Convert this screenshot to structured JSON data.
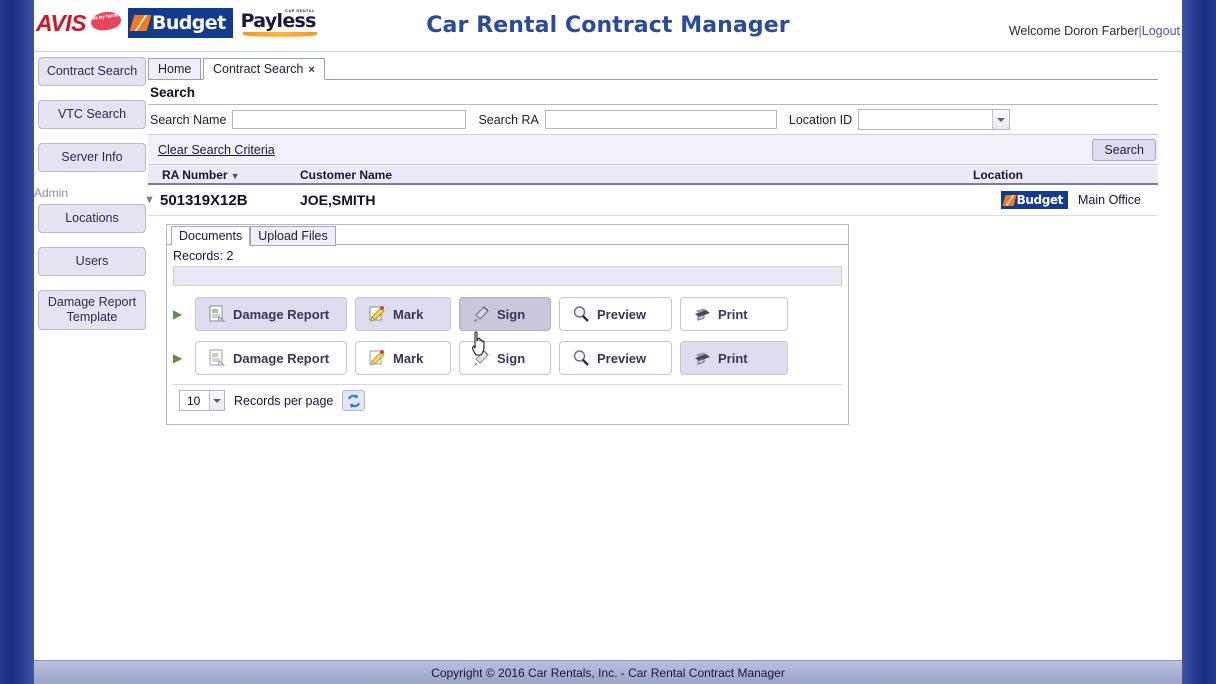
{
  "brand": {
    "avis": "AVIS",
    "avis_tagline": "We try harder",
    "budget": "Budget",
    "payless": "Payless",
    "payless_tagline": "CAR RENTAL",
    "accent_blue": "#123a8f",
    "accent_orange": "#f47a20",
    "title_color": "#2a4b9b"
  },
  "header": {
    "app_title": "Car Rental Contract Manager",
    "welcome_text": "Welcome Doron Farber",
    "separator": "|",
    "logout_label": "Logout"
  },
  "sidebar": {
    "items": [
      {
        "label": "Contract Search"
      },
      {
        "label": "VTC Search"
      },
      {
        "label": "Server Info"
      }
    ],
    "admin_group_label": "Admin",
    "admin_items": [
      {
        "label": "Locations"
      },
      {
        "label": "Users"
      },
      {
        "label": "Damage Report Template"
      }
    ]
  },
  "page_tabs": [
    {
      "label": "Home",
      "active": false,
      "closable": false
    },
    {
      "label": "Contract Search",
      "active": true,
      "closable": true,
      "close_glyph": "×"
    }
  ],
  "search": {
    "heading": "Search",
    "name_label": "Search Name",
    "name_value": "",
    "ra_label": "Search RA",
    "ra_value": "",
    "location_label": "Location ID",
    "location_value": "",
    "clear_link": "Clear Search Criteria",
    "search_button": "Search"
  },
  "results": {
    "columns": {
      "ra_number": "RA Number",
      "sort_caret": "▼",
      "customer_name": "Customer Name",
      "location": "Location"
    },
    "row": {
      "expand_caret": "▼",
      "ra_number": "501319X12B",
      "customer_name": "JOE,SMITH",
      "brand_badge": "Budget",
      "location": "Main Office"
    }
  },
  "detail": {
    "tabs": [
      {
        "label": "Documents",
        "active": true
      },
      {
        "label": "Upload Files",
        "active": false
      }
    ],
    "records_label": "Records:",
    "records_count": "2",
    "rows": [
      {
        "expand_caret": "▶",
        "buttons": [
          {
            "label": "Damage Report",
            "icon": "document-icon",
            "state": "tinted"
          },
          {
            "label": "Mark",
            "icon": "pencil-note-icon",
            "state": "tinted"
          },
          {
            "label": "Sign",
            "icon": "pen-icon",
            "state": "hovered"
          },
          {
            "label": "Preview",
            "icon": "magnifier-icon",
            "state": "plain"
          },
          {
            "label": "Print",
            "icon": "printer-icon",
            "state": "plain"
          }
        ]
      },
      {
        "expand_caret": "▶",
        "buttons": [
          {
            "label": "Damage Report",
            "icon": "document-icon",
            "state": "plain"
          },
          {
            "label": "Mark",
            "icon": "pencil-note-icon",
            "state": "plain"
          },
          {
            "label": "Sign",
            "icon": "pen-icon",
            "state": "plain"
          },
          {
            "label": "Preview",
            "icon": "magnifier-icon",
            "state": "plain"
          },
          {
            "label": "Print",
            "icon": "printer-icon",
            "state": "tinted"
          }
        ]
      }
    ],
    "pager": {
      "records_per_page_value": "10",
      "records_per_page_label": "Records per page",
      "refresh_icon": "refresh-icon"
    }
  },
  "footer": {
    "copyright": "Copyright © 2016 Car Rentals, Inc. - Car Rental Contract Manager"
  }
}
